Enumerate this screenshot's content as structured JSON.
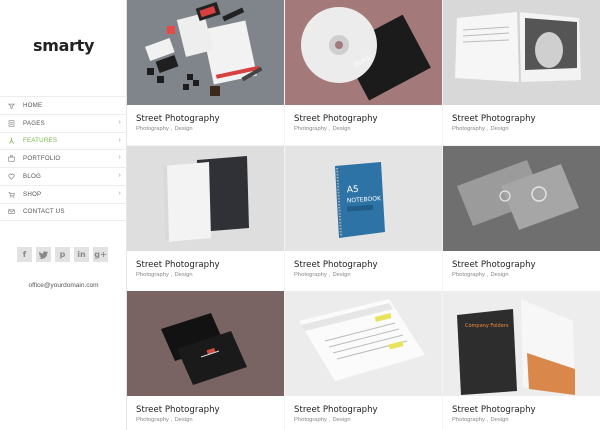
{
  "brand": {
    "logo": "smarty"
  },
  "nav": {
    "items": [
      {
        "label": "HOME",
        "icon": "home-icon",
        "arrow": false,
        "active": false
      },
      {
        "label": "PAGES",
        "icon": "pages-icon",
        "arrow": true,
        "active": false
      },
      {
        "label": "FEATURES",
        "icon": "features-icon",
        "arrow": true,
        "active": true
      },
      {
        "label": "PORTFOLIO",
        "icon": "portfolio-icon",
        "arrow": true,
        "active": false
      },
      {
        "label": "BLOG",
        "icon": "heart-icon",
        "arrow": true,
        "active": false
      },
      {
        "label": "SHOP",
        "icon": "cart-icon",
        "arrow": true,
        "active": false
      },
      {
        "label": "CONTACT US",
        "icon": "mail-icon",
        "arrow": false,
        "active": false
      }
    ]
  },
  "social": [
    {
      "glyph": "f",
      "icon": "facebook-icon"
    },
    {
      "glyph": "t",
      "icon": "twitter-icon"
    },
    {
      "glyph": "p",
      "icon": "pinterest-icon"
    },
    {
      "glyph": "in",
      "icon": "linkedin-icon"
    },
    {
      "glyph": "g+",
      "icon": "googleplus-icon"
    }
  ],
  "contact": {
    "email": "office@yourdomain.com"
  },
  "portfolio": {
    "items": [
      {
        "title": "Street Photography",
        "cat1": "Photography",
        "sep": ",",
        "cat2": "Design",
        "image": "stationery-mockup"
      },
      {
        "title": "Street Photography",
        "cat1": "Photography",
        "sep": ",",
        "cat2": "Design",
        "image": "cd-mockup"
      },
      {
        "title": "Street Photography",
        "cat1": "Photography",
        "sep": ",",
        "cat2": "Design",
        "image": "magazine-mockup"
      },
      {
        "title": "Street Photography",
        "cat1": "Photography",
        "sep": ",",
        "cat2": "Design",
        "image": "books-mockup"
      },
      {
        "title": "Street Photography",
        "cat1": "Photography",
        "sep": ",",
        "cat2": "Design",
        "image": "a5-notebook-mockup",
        "cover_line1": "A5",
        "cover_line2": "NOTEBOOK"
      },
      {
        "title": "Street Photography",
        "cat1": "Photography",
        "sep": ",",
        "cat2": "Design",
        "image": "business-cards-mockup"
      },
      {
        "title": "Street Photography",
        "cat1": "Photography",
        "sep": ",",
        "cat2": "Design",
        "image": "black-cards-mockup"
      },
      {
        "title": "Street Photography",
        "cat1": "Photography",
        "sep": ",",
        "cat2": "Design",
        "image": "resume-mockup"
      },
      {
        "title": "Street Photography",
        "cat1": "Photography",
        "sep": ",",
        "cat2": "Design",
        "image": "folder-mockup",
        "cover_line1": "Company Folders"
      }
    ]
  },
  "colors": {
    "accent": "#7ab648",
    "sidebar_bg": "#ffffff",
    "grid_bg": "#f4f4f4"
  }
}
